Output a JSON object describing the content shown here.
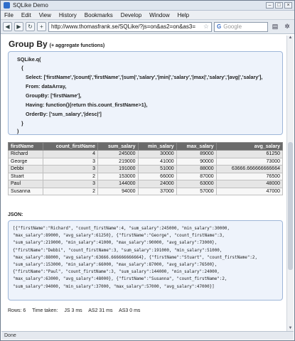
{
  "window": {
    "title": "SQLike Demo"
  },
  "menu": [
    "File",
    "Edit",
    "View",
    "History",
    "Bookmarks",
    "Develop",
    "Window",
    "Help"
  ],
  "toolbar": {
    "url": "http://www.thomasfrank.se/SQLike/?js=on&as2=on&as3=",
    "search_placeholder": "Google"
  },
  "page": {
    "heading": "Group By",
    "heading_note": "(+ aggregate functions)",
    "code": [
      "SQLike.q(",
      "{",
      "Select: ['firstName','|count|','firstName','|sum|','salary','|min|','salary','|max|','salary','|avg|','salary'],",
      "From: dataArray,",
      "GroupBy: ['firstName'],",
      "Having: function(){return this.count_firstName>1},",
      "OrderBy: ['sum_salary','|desc|']",
      "}",
      ")"
    ],
    "table": {
      "headers": [
        "firstName",
        "count_firstName",
        "sum_salary",
        "min_salary",
        "max_salary",
        "avg_salary"
      ],
      "rows": [
        [
          "Richard",
          "4",
          "245000",
          "30000",
          "89000",
          "61250"
        ],
        [
          "George",
          "3",
          "219000",
          "41000",
          "90000",
          "73000"
        ],
        [
          "Debbi",
          "3",
          "191000",
          "51000",
          "88000",
          "63666.666666666664"
        ],
        [
          "Stuart",
          "2",
          "153000",
          "66000",
          "87000",
          "76500"
        ],
        [
          "Paul",
          "3",
          "144000",
          "24000",
          "63000",
          "48000"
        ],
        [
          "Susanna",
          "2",
          "94000",
          "37000",
          "57000",
          "47000"
        ]
      ]
    },
    "json_label": "JSON:",
    "json_lines": [
      "[{\"firstName\":\"Richard\", \"count_firstName\":4, \"sum_salary\":245000, \"min_salary\":30000,",
      "\"max_salary\":89000, \"avg_salary\":61250}, {\"firstName\":\"George\", \"count_firstName\":3,",
      "\"sum_salary\":219000, \"min_salary\":41000, \"max_salary\":90000, \"avg_salary\":73000},",
      "{\"firstName\":\"Debbi\", \"count_firstName\":3, \"sum_salary\":191000, \"min_salary\":51000,",
      "\"max_salary\":88000, \"avg_salary\":63666.666666666664}, {\"firstName\":\"Stuart\", \"count_firstName\":2,",
      "\"sum_salary\":153000, \"min_salary\":66000, \"max_salary\":87000, \"avg_salary\":76500},",
      "{\"firstName\":\"Paul\", \"count_firstName\":3, \"sum_salary\":144000, \"min_salary\":24000,",
      "\"max_salary\":63000, \"avg_salary\":48000}, {\"firstName\":\"Susanna\", \"count_firstName\":2,",
      "\"sum_salary\":94000, \"min_salary\":37000, \"max_salary\":57000, \"avg_salary\":47000}]"
    ],
    "stats": {
      "rows": "Rows: 6",
      "time": "Time taken:",
      "js": "JS 3 ms",
      "as2": "AS2 31 ms",
      "as3": "AS3 0 ms"
    }
  },
  "status": {
    "text": "Done"
  }
}
